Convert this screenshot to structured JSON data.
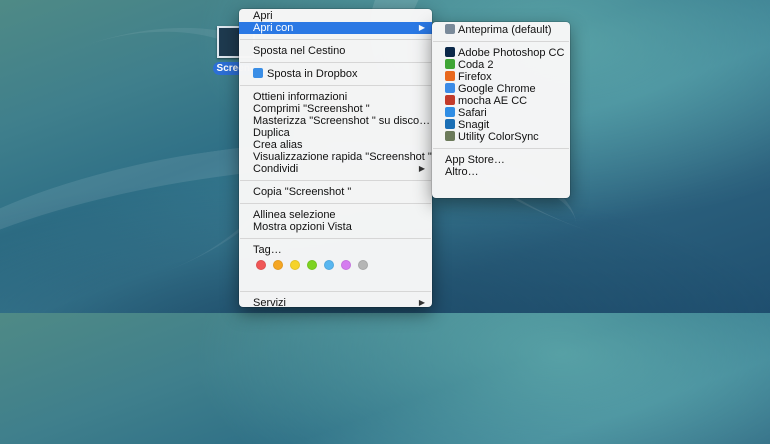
{
  "desktop": {
    "file_label": "Screens"
  },
  "main_menu": {
    "groups": [
      [
        "Apri",
        "Apri con"
      ],
      [
        "Sposta nel Cestino"
      ],
      [
        "Sposta in Dropbox"
      ],
      [
        "Ottieni informazioni",
        "Comprimi \"Screenshot \"",
        "Masterizza \"Screenshot \" su disco…",
        "Duplica",
        "Crea alias",
        "Visualizzazione rapida \"Screenshot \"",
        "Condividi"
      ],
      [
        "Copia \"Screenshot \""
      ],
      [
        "Allinea selezione",
        "Mostra opzioni Vista"
      ],
      [
        "Tag…"
      ],
      [
        "Servizi"
      ]
    ],
    "highlighted": "Apri con",
    "tag_colors": [
      "#f05656",
      "#f5a623",
      "#f6d32a",
      "#7ed321",
      "#58b6f0",
      "#d57cf0",
      "#b5b5b5"
    ]
  },
  "open_with_menu": {
    "default_app": "Anteprima (default)",
    "apps": [
      {
        "label": "Adobe Photoshop CC",
        "icon": "photoshop-icon",
        "color": "#0a2748"
      },
      {
        "label": "Coda 2",
        "icon": "coda-leaf-icon",
        "color": "#3fa535"
      },
      {
        "label": "Firefox",
        "icon": "firefox-icon",
        "color": "#e8681d"
      },
      {
        "label": "Google Chrome",
        "icon": "chrome-icon",
        "color": "#3b8be6"
      },
      {
        "label": "mocha AE CC",
        "icon": "mocha-icon",
        "color": "#c23a2a"
      },
      {
        "label": "Safari",
        "icon": "safari-icon",
        "color": "#2f8de4"
      },
      {
        "label": "Snagit",
        "icon": "snagit-icon",
        "color": "#1b6fb5"
      },
      {
        "label": "Utility ColorSync",
        "icon": "colorsync-icon",
        "color": "#6b7a5a"
      }
    ],
    "footer": [
      "App Store…",
      "Altro…"
    ]
  }
}
